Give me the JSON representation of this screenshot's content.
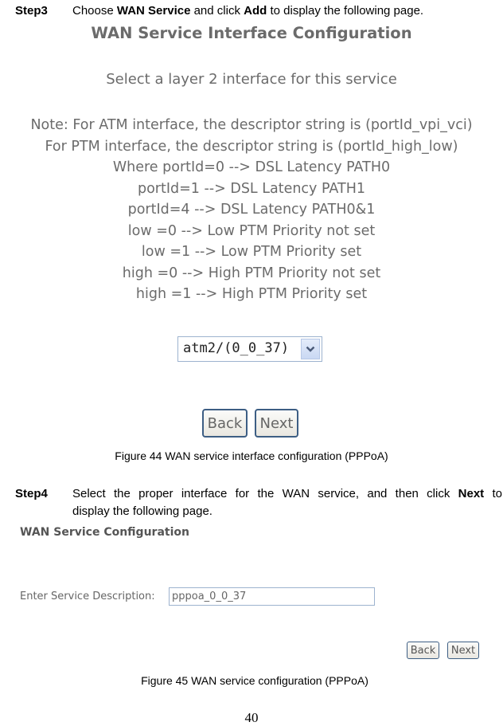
{
  "step3": {
    "label": "Step3",
    "text_parts": [
      "Choose ",
      "WAN Service",
      " and click ",
      "Add",
      " to display the following page."
    ]
  },
  "figure44": {
    "title": "WAN Service Interface Configuration",
    "subtitle": "Select a layer 2 interface for this service",
    "note_lines": [
      "Note: For ATM interface, the descriptor string is (portId_vpi_vci)",
      "For PTM interface, the descriptor string is (portId_high_low)",
      "Where portId=0 --> DSL Latency PATH0",
      "portId=1 --> DSL Latency PATH1",
      "portId=4 --> DSL Latency PATH0&1",
      "low =0 --> Low PTM Priority not set",
      "low =1 --> Low PTM Priority set",
      "high =0 --> High PTM Priority not set",
      "high =1 --> High PTM Priority set"
    ],
    "interface_select": {
      "selected": "atm2/(0_0_37)",
      "arrow_icon": "chevron-down-icon"
    },
    "back_label": "Back",
    "next_label": "Next",
    "caption": "Figure 44 WAN service interface configuration (PPPoA)"
  },
  "step4": {
    "label": "Step4",
    "text_line1_parts": [
      "Select the proper interface for the WAN service, and then click ",
      "Next",
      " to"
    ],
    "text_line2": "display the following page."
  },
  "figure45": {
    "title": "WAN Service Configuration",
    "service_description_label": "Enter Service Description:",
    "service_description_value": "pppoa_0_0_37",
    "back_label": "Back",
    "next_label": "Next",
    "caption": "Figure 45 WAN service configuration (PPPoA)"
  },
  "page_number": "40"
}
